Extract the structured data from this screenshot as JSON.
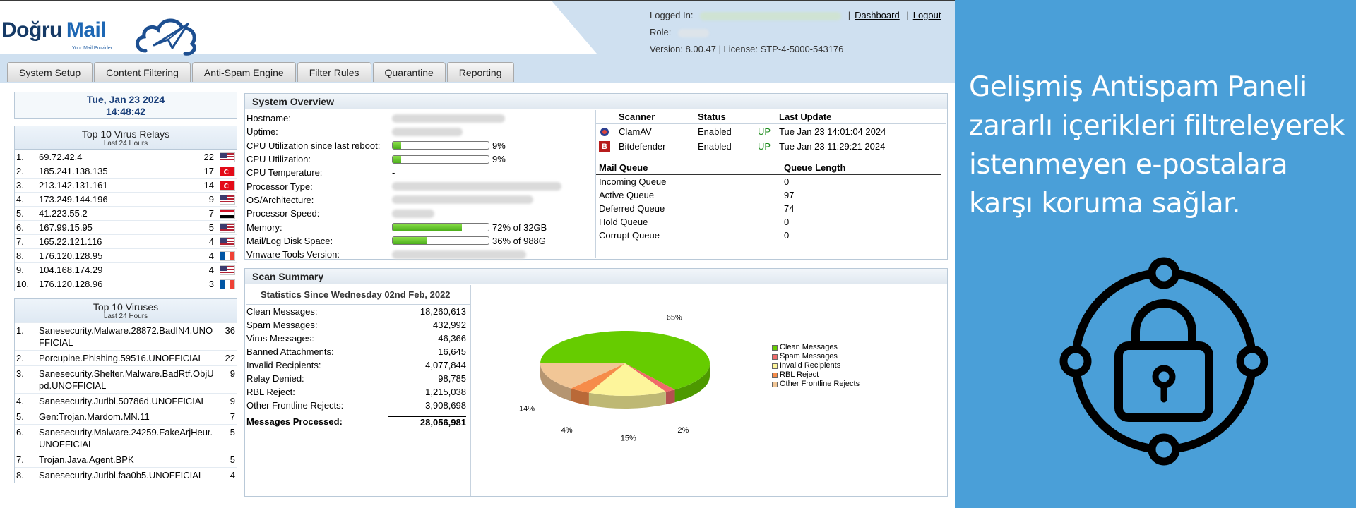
{
  "brand": {
    "name_part1": "Doğru",
    "name_part2": "Mail",
    "tagline": "Your Mail Provider"
  },
  "header": {
    "logged_in_label": "Logged In:",
    "dashboard_link": "Dashboard",
    "logout_link": "Logout",
    "role_label": "Role:",
    "version_line": "Version: 8.00.47  |  License: STP-4-5000-543176"
  },
  "tabs": [
    "System Setup",
    "Content Filtering",
    "Anti-Spam Engine",
    "Filter Rules",
    "Quarantine",
    "Reporting"
  ],
  "datetime": {
    "date": "Tue, Jan 23 2024",
    "time": "14:48:42"
  },
  "relays": {
    "title": "Top 10 Virus Relays",
    "subtitle": "Last 24 Hours",
    "rows": [
      {
        "n": "1.",
        "ip": "69.72.42.4",
        "count": "22",
        "flag": "us"
      },
      {
        "n": "2.",
        "ip": "185.241.138.135",
        "count": "17",
        "flag": "tr"
      },
      {
        "n": "3.",
        "ip": "213.142.131.161",
        "count": "14",
        "flag": "tr"
      },
      {
        "n": "4.",
        "ip": "173.249.144.196",
        "count": "9",
        "flag": "us"
      },
      {
        "n": "5.",
        "ip": "41.223.55.2",
        "count": "7",
        "flag": "eg"
      },
      {
        "n": "6.",
        "ip": "167.99.15.95",
        "count": "5",
        "flag": "us"
      },
      {
        "n": "7.",
        "ip": "165.22.121.116",
        "count": "4",
        "flag": "us"
      },
      {
        "n": "8.",
        "ip": "176.120.128.95",
        "count": "4",
        "flag": "fr"
      },
      {
        "n": "9.",
        "ip": "104.168.174.29",
        "count": "4",
        "flag": "us"
      },
      {
        "n": "10.",
        "ip": "176.120.128.96",
        "count": "3",
        "flag": "fr"
      }
    ]
  },
  "viruses": {
    "title": "Top 10 Viruses",
    "subtitle": "Last 24 Hours",
    "rows": [
      {
        "n": "1.",
        "name": "Sanesecurity.Malware.28872.BadIN4.UNOFFICIAL",
        "count": "36"
      },
      {
        "n": "2.",
        "name": "Porcupine.Phishing.59516.UNOFFICIAL",
        "count": "22"
      },
      {
        "n": "3.",
        "name": "Sanesecurity.Shelter.Malware.BadRtf.ObjUpd.UNOFFICIAL",
        "count": "9"
      },
      {
        "n": "4.",
        "name": "Sanesecurity.Jurlbl.50786d.UNOFFICIAL",
        "count": "9"
      },
      {
        "n": "5.",
        "name": "Gen:Trojan.Mardom.MN.11",
        "count": "7"
      },
      {
        "n": "6.",
        "name": "Sanesecurity.Malware.24259.FakeArjHeur.UNOFFICIAL",
        "count": "5"
      },
      {
        "n": "7.",
        "name": "Trojan.Java.Agent.BPK",
        "count": "5"
      },
      {
        "n": "8.",
        "name": "Sanesecurity.Jurlbl.faa0b5.UNOFFICIAL",
        "count": "4"
      }
    ]
  },
  "overview": {
    "title": "System Overview",
    "rows": [
      {
        "label": "Hostname:",
        "value": "",
        "blur": 160
      },
      {
        "label": "Uptime:",
        "value": "",
        "blur": 100
      },
      {
        "label": "CPU Utilization since last reboot:",
        "bar": 0.09,
        "value": "9%"
      },
      {
        "label": "CPU Utilization:",
        "bar": 0.09,
        "value": "9%"
      },
      {
        "label": "CPU Temperature:",
        "value": "-"
      },
      {
        "label": "Processor Type:",
        "value": "",
        "blur": 240
      },
      {
        "label": "OS/Architecture:",
        "value": "",
        "blur": 200
      },
      {
        "label": "Processor Speed:",
        "value": "",
        "blur": 60
      },
      {
        "label": "Memory:",
        "bar": 0.72,
        "value": "72% of 32GB"
      },
      {
        "label": "Mail/Log Disk Space:",
        "bar": 0.36,
        "value": "36% of 988G"
      },
      {
        "label": "Vmware Tools Version:",
        "value": "",
        "blur": 190
      }
    ],
    "scanner_headers": {
      "scanner": "Scanner",
      "status": "Status",
      "update": "Last Update"
    },
    "scanners": [
      {
        "name": "ClamAV",
        "status": "Enabled",
        "up": "UP",
        "update": "Tue Jan 23 14:01:04 2024",
        "icon": "clamav-icon"
      },
      {
        "name": "Bitdefender",
        "status": "Enabled",
        "up": "UP",
        "update": "Tue Jan 23 11:29:21 2024",
        "icon": "bitdefender-icon"
      }
    ],
    "queue_headers": {
      "queue": "Mail Queue",
      "length": "Queue Length"
    },
    "queues": [
      {
        "name": "Incoming Queue",
        "length": "0"
      },
      {
        "name": "Active Queue",
        "length": "97"
      },
      {
        "name": "Deferred Queue",
        "length": "74"
      },
      {
        "name": "Hold Queue",
        "length": "0"
      },
      {
        "name": "Corrupt Queue",
        "length": "0"
      }
    ]
  },
  "scan": {
    "title": "Scan Summary",
    "since": "Statistics Since Wednesday 02nd Feb, 2022",
    "rows": [
      {
        "label": "Clean Messages:",
        "value": "18,260,613"
      },
      {
        "label": "Spam Messages:",
        "value": "432,992"
      },
      {
        "label": "Virus Messages:",
        "value": "46,366"
      },
      {
        "label": "Banned Attachments:",
        "value": "16,645"
      },
      {
        "label": "Invalid Recipients:",
        "value": "4,077,844"
      },
      {
        "label": "Relay Denied:",
        "value": "98,785"
      },
      {
        "label": "RBL Reject:",
        "value": "1,215,038"
      },
      {
        "label": "Other Frontline Rejects:",
        "value": "3,908,698"
      }
    ],
    "total": {
      "label": "Messages Processed:",
      "value": "28,056,981"
    }
  },
  "chart_data": {
    "type": "pie",
    "categories": [
      "Clean Messages",
      "Spam Messages",
      "Invalid Recipients",
      "RBL Reject",
      "Other Frontline Rejects"
    ],
    "values": [
      65,
      2,
      15,
      4,
      14
    ],
    "labels": [
      "65%",
      "2%",
      "15%",
      "4%",
      "14%"
    ],
    "colors": [
      "#66cc00",
      "#f06a6a",
      "#fdf59b",
      "#f68c4a",
      "#f1c696"
    ],
    "legend_position": "right"
  },
  "promo": {
    "text": "Gelişmiş Antispam Paneli zararlı içerikleri filtreleyerek istenmeyen e-postalara karşı koruma sağlar.",
    "bg": "#4a9fd8"
  }
}
